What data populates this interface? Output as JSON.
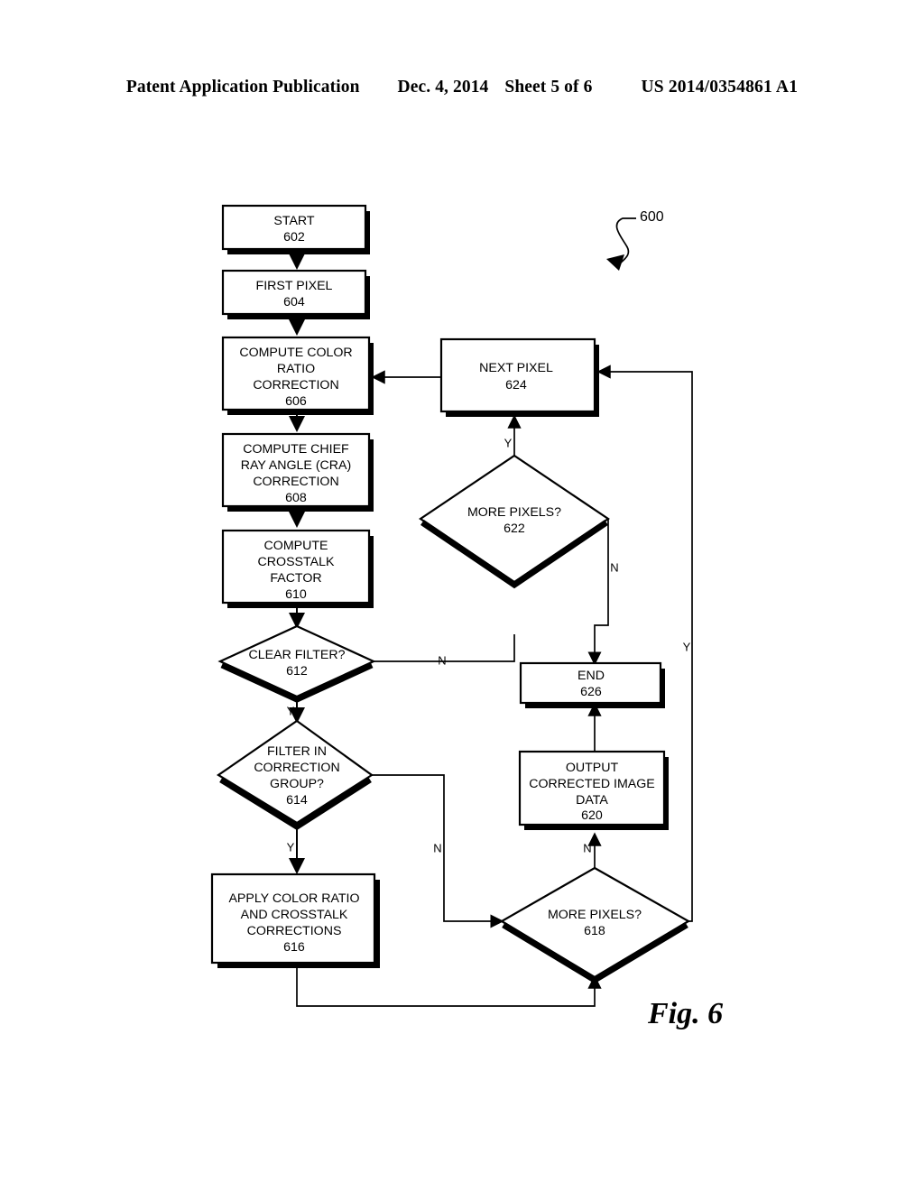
{
  "header": {
    "publication": "Patent Application Publication",
    "date": "Dec. 4, 2014",
    "sheet": "Sheet 5 of 6",
    "number": "US 2014/0354861 A1"
  },
  "figure": {
    "caption": "Fig. 6",
    "reference_numeral": "600"
  },
  "chart_data": {
    "type": "diagram",
    "title": "Fig. 6",
    "diagram_kind": "flowchart",
    "reference": "600",
    "nodes": [
      {
        "id": "602",
        "shape": "process",
        "lines": [
          "START",
          "602"
        ]
      },
      {
        "id": "604",
        "shape": "process",
        "lines": [
          "FIRST PIXEL",
          "604"
        ]
      },
      {
        "id": "606",
        "shape": "process",
        "lines": [
          "COMPUTE COLOR",
          "RATIO",
          "CORRECTION",
          "606"
        ]
      },
      {
        "id": "608",
        "shape": "process",
        "lines": [
          "COMPUTE CHIEF",
          "RAY ANGLE (CRA)",
          "CORRECTION",
          "608"
        ]
      },
      {
        "id": "610",
        "shape": "process",
        "lines": [
          "COMPUTE",
          "CROSSTALK",
          "FACTOR",
          "610"
        ]
      },
      {
        "id": "612",
        "shape": "decision",
        "lines": [
          "CLEAR FILTER?",
          "612"
        ]
      },
      {
        "id": "614",
        "shape": "decision",
        "lines": [
          "FILTER IN",
          "CORRECTION",
          "GROUP?",
          "614"
        ]
      },
      {
        "id": "616",
        "shape": "process",
        "lines": [
          "APPLY COLOR RATIO",
          "AND CROSSTALK",
          "CORRECTIONS",
          "616"
        ]
      },
      {
        "id": "618",
        "shape": "decision",
        "lines": [
          "MORE PIXELS?",
          "618"
        ]
      },
      {
        "id": "620",
        "shape": "process",
        "lines": [
          "OUTPUT",
          "CORRECTED IMAGE",
          "DATA",
          "620"
        ]
      },
      {
        "id": "622",
        "shape": "decision",
        "lines": [
          "MORE PIXELS?",
          "622"
        ]
      },
      {
        "id": "624",
        "shape": "process",
        "lines": [
          "NEXT PIXEL",
          "624"
        ]
      },
      {
        "id": "626",
        "shape": "process",
        "lines": [
          "END",
          "626"
        ]
      }
    ],
    "edges": [
      {
        "from": "602",
        "to": "604",
        "label": ""
      },
      {
        "from": "604",
        "to": "606",
        "label": ""
      },
      {
        "from": "606",
        "to": "608",
        "label": ""
      },
      {
        "from": "608",
        "to": "610",
        "label": ""
      },
      {
        "from": "610",
        "to": "612",
        "label": ""
      },
      {
        "from": "612",
        "to": "614",
        "label": "Y"
      },
      {
        "from": "612",
        "to": "622",
        "label": "N"
      },
      {
        "from": "614",
        "to": "616",
        "label": "Y"
      },
      {
        "from": "614",
        "to": "618",
        "label": "N"
      },
      {
        "from": "616",
        "to": "618",
        "label": ""
      },
      {
        "from": "618",
        "to": "620",
        "label": "N"
      },
      {
        "from": "618",
        "to": "624",
        "label": "Y"
      },
      {
        "from": "620",
        "to": "626",
        "label": ""
      },
      {
        "from": "622",
        "to": "624",
        "label": "Y"
      },
      {
        "from": "622",
        "to": "626",
        "label": "N"
      },
      {
        "from": "624",
        "to": "606",
        "label": ""
      }
    ],
    "edge_labels": {
      "y612": "Y",
      "n612": "N",
      "y614": "Y",
      "n614": "N",
      "n618": "N",
      "y618": "Y",
      "y622": "Y",
      "n622": "N"
    }
  }
}
